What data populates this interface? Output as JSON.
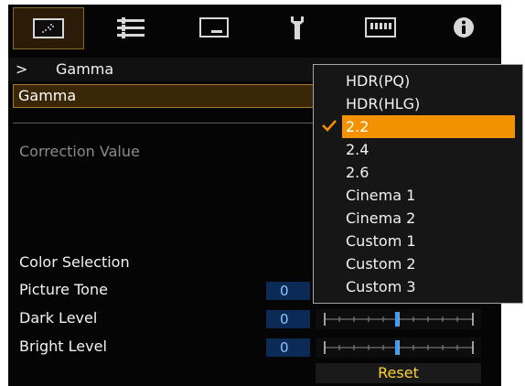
{
  "tabs": [
    {
      "icon": "picture-icon",
      "active": true
    },
    {
      "icon": "adjustment-sliders-icon",
      "active": false
    },
    {
      "icon": "display-icon",
      "active": false
    },
    {
      "icon": "wrench-icon",
      "active": false
    },
    {
      "icon": "input-terminal-icon",
      "active": false
    },
    {
      "icon": "info-icon",
      "active": false
    }
  ],
  "breadcrumb": {
    "chevron": ">",
    "title": "Gamma"
  },
  "gamma_row": {
    "label": "Gamma"
  },
  "correction_value": {
    "label": "Correction Value"
  },
  "color_selection": {
    "label": "Color Selection"
  },
  "picture_tone": {
    "label": "Picture Tone",
    "value": "0",
    "level": 0
  },
  "dark_level": {
    "label": "Dark Level",
    "value": "0",
    "level": 0
  },
  "bright_level": {
    "label": "Bright Level",
    "value": "0",
    "level": 0
  },
  "reset": {
    "label": "Reset"
  },
  "dropdown": {
    "selected_index": 2,
    "options": [
      "HDR(PQ)",
      "HDR(HLG)",
      "2.2",
      "2.4",
      "2.6",
      "Cinema 1",
      "Cinema 2",
      "Custom 1",
      "Custom 2",
      "Custom 3"
    ]
  },
  "colors": {
    "accent_orange": "#f39200",
    "active_tab_bg": "#2b1b07",
    "value_text": "#8ec4ff",
    "reset_text": "#ffd23a",
    "slider_marker": "#39a0ff"
  }
}
